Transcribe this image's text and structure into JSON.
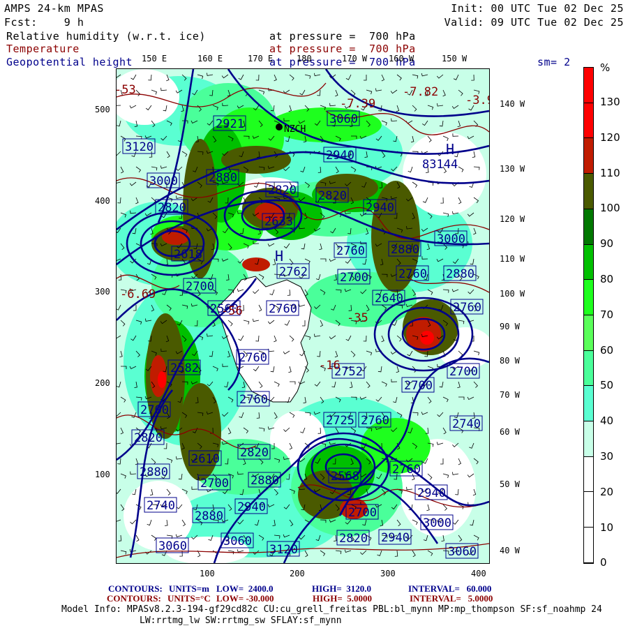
{
  "header": {
    "model": "AMPS 24-km MPAS",
    "forecast": "Fcst:    9 h",
    "init": "Init: 00 UTC Tue 02 Dec 25",
    "valid": "Valid: 09 UTC Tue 02 Dec 25",
    "field1_name": "Relative humidity (w.r.t. ice)",
    "field1_level": "at pressure =  700 hPa",
    "field2_name": "Temperature",
    "field2_level": "at pressure =  700 hPa",
    "field3_name": "Geopotential height",
    "field3_level": "at pressure =  700 hPa",
    "smoothing": "sm= 2"
  },
  "map": {
    "top_lon_labels": [
      "150 E",
      "160 E",
      "170 E",
      "180",
      "170 W",
      "160 W",
      "150 W"
    ],
    "right_lon_labels": [
      "140 W",
      "130 W",
      "120 W",
      "110 W",
      "100 W",
      "90 W",
      "80 W",
      "70 W",
      "60 W",
      "50 W",
      "40 W"
    ],
    "y_ticks": [
      "500",
      "400",
      "300",
      "200",
      "100"
    ],
    "x_ticks": [
      "100",
      "200",
      "300",
      "400"
    ],
    "station_label": "NZCH",
    "height_labels": [
      "3060",
      "2940",
      "2921",
      "3120",
      "3000",
      "2880",
      "2820",
      "2820",
      "2940",
      "2820",
      "2633",
      "2618",
      "2760",
      "2880",
      "3000",
      "2762",
      "2700",
      "2760",
      "2880",
      "2700",
      "2640",
      "2760",
      "2560",
      "2760",
      "2760",
      "2582",
      "2752",
      "2700",
      "2700",
      "2760",
      "2700",
      "2725",
      "2760",
      "2740",
      "2820",
      "2610",
      "2820",
      "2880",
      "2568",
      "2760",
      "2700",
      "2880",
      "2940",
      "2740",
      "2880",
      "2940",
      "2700",
      "3000",
      "2820",
      "2940",
      "3060",
      "3060",
      "3120",
      "3060"
    ],
    "temp_labels": [
      "-7.82",
      "-3.9",
      "-7.39",
      "-35",
      "-53",
      "-6.69",
      "-56",
      "-16"
    ],
    "high_markers": [
      "H",
      "H"
    ],
    "high_value": "83144"
  },
  "colorbar": {
    "unit": "%",
    "labels": [
      "130",
      "120",
      "110",
      "100",
      "90",
      "80",
      "70",
      "60",
      "50",
      "40",
      "30",
      "20",
      "10",
      "0"
    ],
    "colors": [
      "#ff0000",
      "#ff0000",
      "#c01c00",
      "#4a5a00",
      "#007800",
      "#00c000",
      "#1eff1e",
      "#5aff5a",
      "#4aff9a",
      "#5affd2",
      "#c8ffe8",
      "#ffffff",
      "#ffffff",
      "#ffffff"
    ]
  },
  "footer": {
    "c1_label": "CONTOURS:",
    "c1_units": "UNITS=m",
    "c1_low": "LOW=  2400.0",
    "c1_high": "HIGH=  3120.0",
    "c1_int": "INTERVAL=   60.000",
    "c2_label": "CONTOURS:",
    "c2_units": "UNITS=°C",
    "c2_low": "LOW= -30.000",
    "c2_high": "HIGH=  5.0000",
    "c2_int": "INTERVAL=   5.0000",
    "model_info1": "Model Info: MPASv8.2.3-194-gf29cd82c CU:cu_grell_freitas PBL:bl_mynn MP:mp_thompson SF:sf_noahmp 24",
    "model_info2": "LW:rrtmg_lw SW:rrtmg_sw SFLAY:sf_mynn"
  },
  "colors": {
    "height_contour": "#00008b",
    "temp_contour": "#8b0000",
    "land": "#ffffff"
  }
}
